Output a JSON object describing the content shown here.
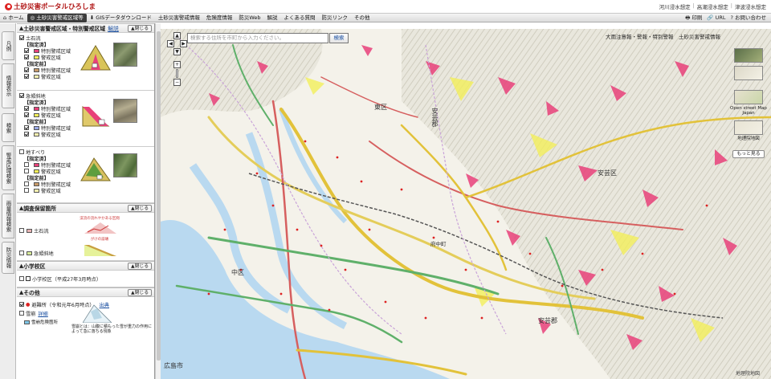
{
  "header": {
    "title": "土砂災害ポータルひろしま",
    "top_links": [
      "河川浸水想定",
      "高潮浸水想定",
      "津波浸水想定"
    ]
  },
  "menu": {
    "items": [
      "ホーム",
      "土砂災害警戒区域等",
      "GISデータダウンロード",
      "土砂災害警戒情報",
      "危険度情報",
      "防災Web",
      "解説",
      "よくある質問",
      "防災リンク",
      "その他"
    ],
    "right": [
      "印刷",
      "URL",
      "お問い合わせ"
    ]
  },
  "vtabs": [
    "凡例",
    "情報表示",
    "検索",
    "警戒区域検索",
    "雨量情報検索",
    "防災情報"
  ],
  "panel": {
    "section1": {
      "title": "土砂災害警戒区域・特別警戒区域",
      "link": "解説",
      "close": "閉じる"
    },
    "groups": [
      {
        "name": "土石流",
        "checked": true,
        "designated": "【指定済】",
        "planned": "【指定前】",
        "special": "特別警戒区域",
        "warning": "警戒区域",
        "special_color": "#e8417a",
        "warning_color": "#f3ef5a",
        "special_pre_color": "#c79a6a",
        "warning_pre_color": "#f7f1b0"
      },
      {
        "name": "急傾斜地",
        "checked": true,
        "designated": "【指定済】",
        "planned": "【指定前】",
        "special": "特別警戒区域",
        "warning": "警戒区域",
        "special_color": "#e8417a",
        "warning_color": "#f3ef5a",
        "special_pre_color": "#9aa9e6",
        "warning_pre_color": "#f7f1b0"
      },
      {
        "name": "地すべり",
        "checked": false,
        "designated": "【指定済】",
        "planned": "【指定前】",
        "special": "特別警戒区域",
        "warning": "警戒区域",
        "special_color": "#e8417a",
        "warning_color": "#f3ef5a",
        "special_pre_color": "#c79a6a",
        "warning_pre_color": "#f7f1b0"
      }
    ],
    "section2": {
      "title": "調査保留箇所",
      "close": "閉じる",
      "items": [
        "土石流",
        "急傾斜地"
      ],
      "caption1": "渓流の流れやかある区間",
      "caption2": "がけの崩壊"
    },
    "section3": {
      "title": "小学校区",
      "close": "閉じる",
      "item": "小学校区（平成27年3月時点）"
    },
    "section4": {
      "title": "その他",
      "close": "閉じる",
      "shelter": "避難所（令和元年6月時点）",
      "shelter_link": "出典",
      "rain": "雪崩",
      "rain_link": "詳細",
      "danger": "雪崩危険箇所",
      "desc": "雪崩とは：山腹に積もった雪が重力の作用によって急に落ちる現象"
    }
  },
  "map": {
    "search_placeholder": "検索する住所を市町から入力ください。",
    "search_button": "検索",
    "legend_title": "大雨注意報・警報・特別警報",
    "legend_title2": "土砂災害警戒情報",
    "layers": [
      "Open street Map Japan",
      "地理院地図"
    ],
    "more": "もっと見る",
    "labels": [
      "東区",
      "安芸区",
      "中区",
      "安芸郡",
      "安芸郡",
      "府中町",
      "広島市"
    ],
    "attribution": "地理院地図"
  }
}
